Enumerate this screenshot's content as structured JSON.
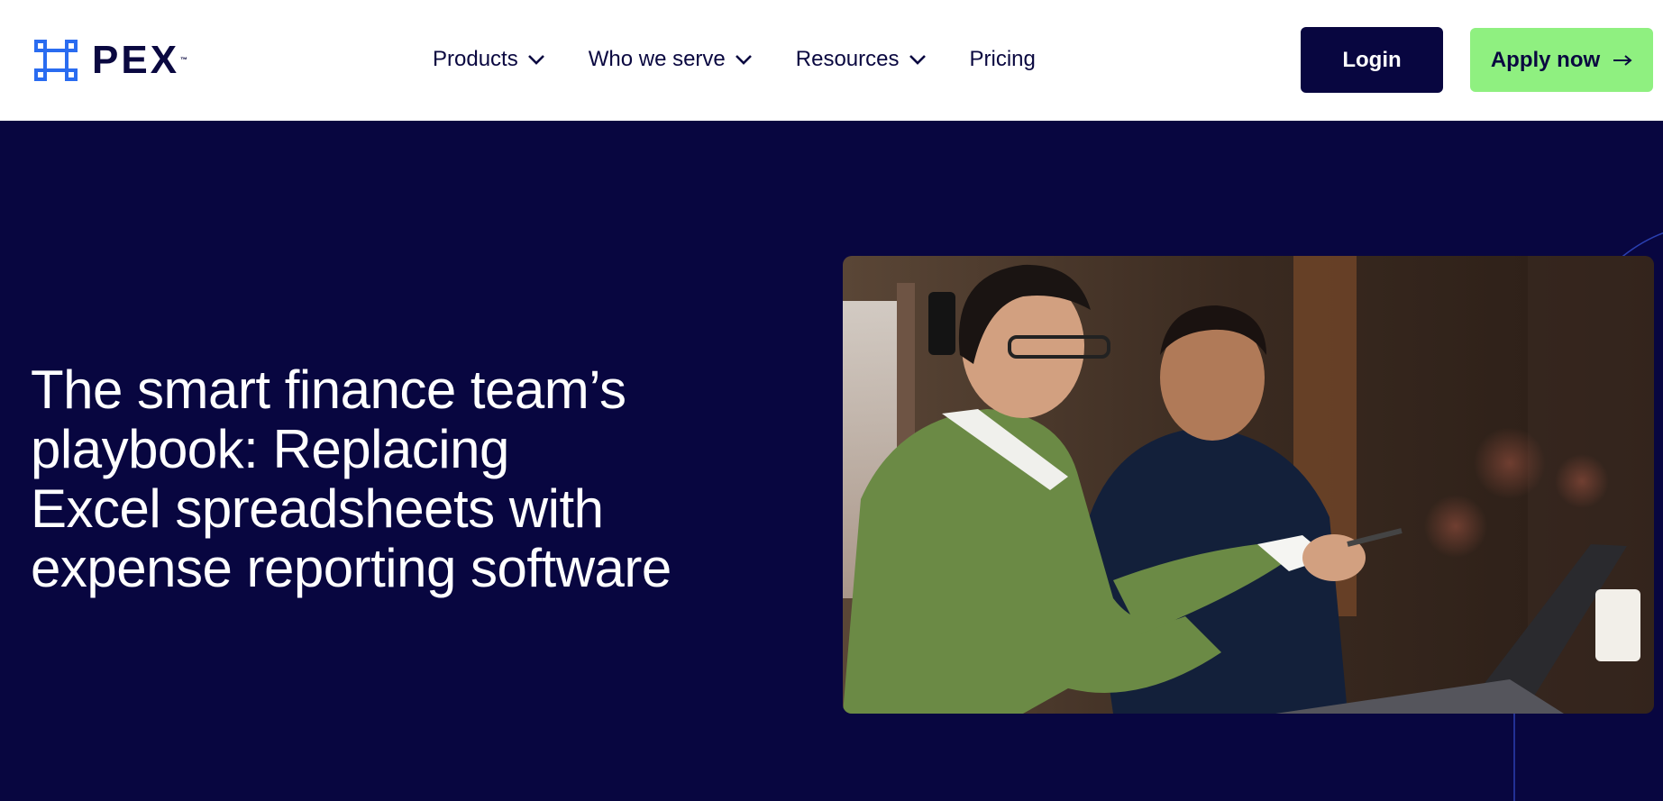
{
  "brand": {
    "name": "PEX",
    "trademark": "™",
    "icon": "pex-logo-icon",
    "color": "#2a6cf0"
  },
  "nav": {
    "items": [
      {
        "label": "Products",
        "has_dropdown": true
      },
      {
        "label": "Who we serve",
        "has_dropdown": true
      },
      {
        "label": "Resources",
        "has_dropdown": true
      },
      {
        "label": "Pricing",
        "has_dropdown": false
      }
    ]
  },
  "actions": {
    "login_label": "Login",
    "apply_label": "Apply now",
    "apply_icon": "arrow-right-icon"
  },
  "hero": {
    "title_lines": [
      "The smart finance team’s",
      "playbook: Replacing",
      "Excel spreadsheets with",
      "expense reporting software"
    ],
    "image": "photo of two colleagues reviewing expenses on a laptop"
  },
  "colors": {
    "navy": "#080640",
    "accent_green": "#8ff080",
    "header_bg": "#ffffff"
  }
}
